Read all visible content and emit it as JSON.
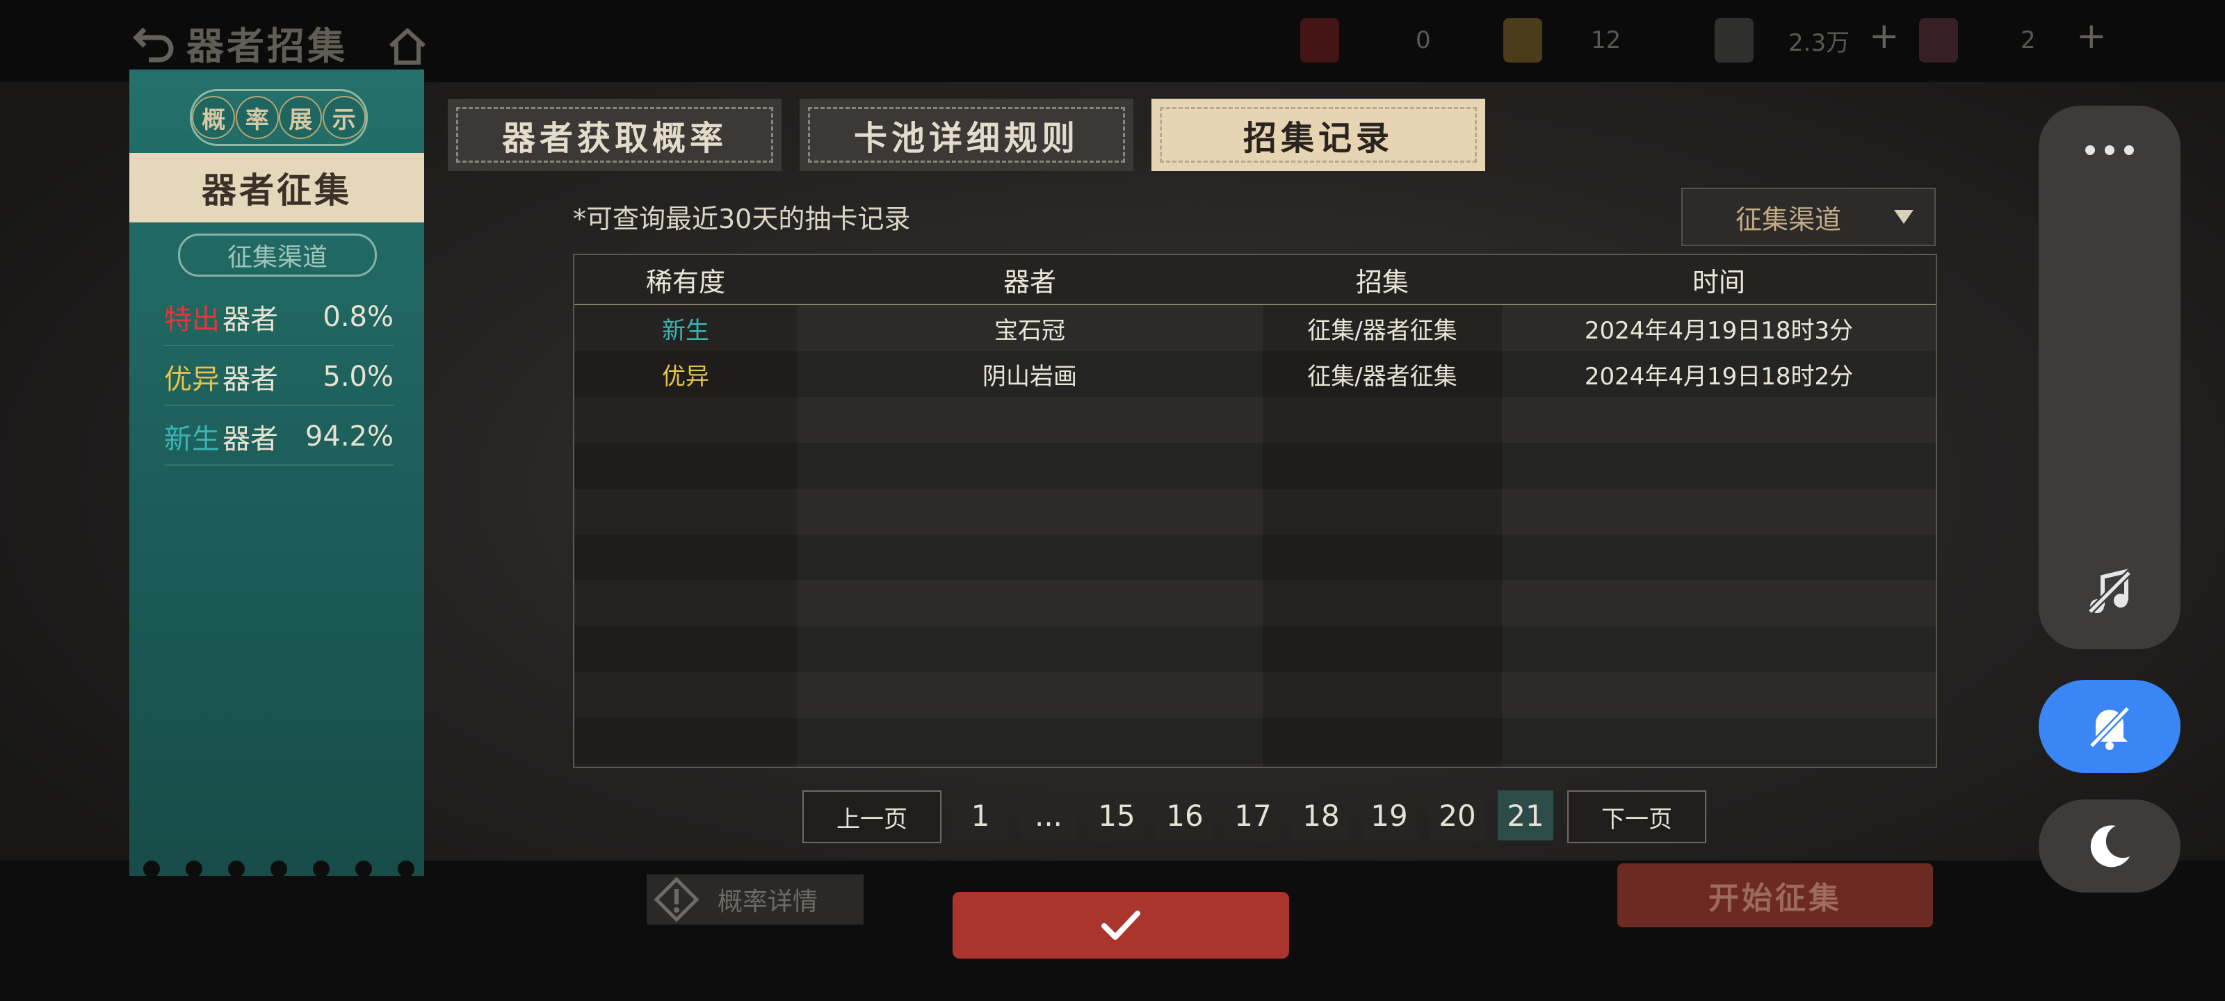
{
  "header": {
    "title": "器者招集",
    "resources": [
      {
        "icon": "red-token-icon",
        "value": "0"
      },
      {
        "icon": "gold-figure-icon",
        "value": "12"
      },
      {
        "icon": "coin-box-icon",
        "value": "2.3万"
      },
      {
        "icon": "compass-ticket-icon",
        "value": "2"
      }
    ],
    "plus": "+"
  },
  "left_panel": {
    "stamp_chars": [
      "概",
      "率",
      "展",
      "示"
    ],
    "banner": "器者征集",
    "channel": "征集渠道",
    "rates": [
      {
        "tag": "特出",
        "tag_color": "#e2383a",
        "label": "器者",
        "value": "0.8%"
      },
      {
        "tag": "优异",
        "tag_color": "#e9c24a",
        "label": "器者",
        "value": "5.0%"
      },
      {
        "tag": "新生",
        "tag_color": "#39b6b2",
        "label": "器者",
        "value": "94.2%"
      }
    ]
  },
  "tabs": [
    {
      "label": "器者获取概率",
      "active": false
    },
    {
      "label": "卡池详细规则",
      "active": false
    },
    {
      "label": "招集记录",
      "active": true
    }
  ],
  "records": {
    "note": "*可查询最近30天的抽卡记录",
    "filter_label": "征集渠道",
    "columns": [
      "稀有度",
      "器者",
      "招集",
      "时间"
    ],
    "rows": [
      {
        "rarity": "新生",
        "rarity_color": "#39b6b2",
        "name": "宝石冠",
        "source": "征集/器者征集",
        "time": "2024年4月19日18时3分"
      },
      {
        "rarity": "优异",
        "rarity_color": "#e9c24a",
        "name": "阴山岩画",
        "source": "征集/器者征集",
        "time": "2024年4月19日18时2分"
      }
    ]
  },
  "pagination": {
    "prev": "上一页",
    "next": "下一页",
    "pages": [
      "1",
      "...",
      "15",
      "16",
      "17",
      "18",
      "19",
      "20",
      "21"
    ],
    "current": "21"
  },
  "bottom": {
    "prob_details": "概率详情",
    "start": "开始征集",
    "confirm_icon": "checkmark-icon"
  },
  "side_controls": {
    "menu_icon": "more-dots-icon",
    "music_icon": "music-off-icon",
    "bell_icon": "bell-off-icon",
    "moon_icon": "moon-icon",
    "accent": "#3a86f4"
  }
}
